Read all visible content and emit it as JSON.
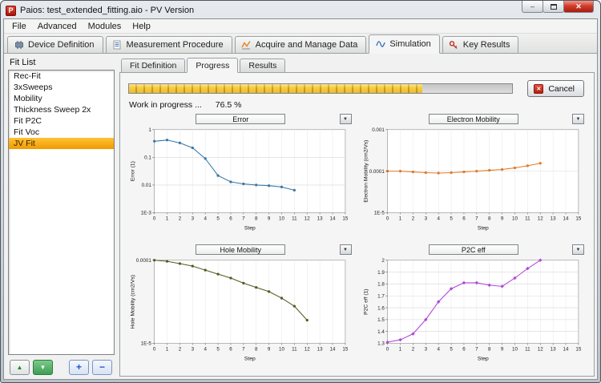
{
  "window": {
    "title": "Paios: test_extended_fitting.aio - PV Version",
    "icon_letter": "P",
    "menu": [
      "File",
      "Advanced",
      "Modules",
      "Help"
    ]
  },
  "glyphs": {
    "minimize": "–",
    "close": "✕",
    "cancel_x": "✕",
    "up_arrow": "▲",
    "down_arrow": "▼",
    "plus": "+",
    "minus": "−",
    "dropdown_arrow": "▼"
  },
  "tabs": {
    "active": "Simulation",
    "items": [
      {
        "label": "Device Definition",
        "icon": "device-icon"
      },
      {
        "label": "Measurement Procedure",
        "icon": "procedure-icon"
      },
      {
        "label": "Acquire and Manage Data",
        "icon": "acquire-data-icon"
      },
      {
        "label": "Simulation",
        "icon": "simulation-icon"
      },
      {
        "label": "Key Results",
        "icon": "key-results-icon"
      }
    ]
  },
  "fit_list": {
    "label": "Fit List",
    "selected": "JV Fit",
    "items": [
      "Rec-Fit",
      "3xSweeps",
      "Mobility",
      "Thickness Sweep 2x",
      "Fit P2C",
      "Fit Voc",
      "JV Fit"
    ]
  },
  "sub_tabs": {
    "active": "Progress",
    "items": [
      "Fit Definition",
      "Progress",
      "Results"
    ]
  },
  "progress": {
    "status_text": "Work in progress ...",
    "percent_text": "76.5 %",
    "percent": 76.5,
    "cancel_label": "Cancel",
    "bar_color": "#f8ca3e"
  },
  "chart_data": [
    {
      "type": "line",
      "title": "Error",
      "xlabel": "Step",
      "ylabel": "Error (1)",
      "yscale": "log",
      "xlim": [
        0,
        15
      ],
      "ylim": [
        0.001,
        1
      ],
      "xticks": [
        0,
        1,
        2,
        3,
        4,
        5,
        6,
        7,
        8,
        9,
        10,
        11,
        12,
        13,
        14,
        15
      ],
      "yticks": [
        {
          "v": 1,
          "label": "1"
        },
        {
          "v": 0.1,
          "label": "0.1"
        },
        {
          "v": 0.01,
          "label": "0.01"
        },
        {
          "v": 0.001,
          "label": "1E-3"
        }
      ],
      "color": "#3878a8",
      "marker": "circle",
      "grid": true,
      "x": [
        0,
        1,
        2,
        3,
        4,
        5,
        6,
        7,
        8,
        9,
        10,
        11
      ],
      "y": [
        0.38,
        0.42,
        0.33,
        0.22,
        0.09,
        0.022,
        0.013,
        0.011,
        0.01,
        0.0095,
        0.0085,
        0.0065
      ]
    },
    {
      "type": "line",
      "title": "Electron Mobility",
      "xlabel": "Step",
      "ylabel": "Electron Mobility (cm2/Vs)",
      "yscale": "log",
      "xlim": [
        0,
        15
      ],
      "ylim": [
        1e-05,
        0.001
      ],
      "xticks": [
        0,
        1,
        2,
        3,
        4,
        5,
        6,
        7,
        8,
        9,
        10,
        11,
        12,
        13,
        14,
        15
      ],
      "yticks": [
        {
          "v": 0.001,
          "label": "0.001"
        },
        {
          "v": 0.0001,
          "label": "0.0001"
        },
        {
          "v": 1e-05,
          "label": "1E-5"
        }
      ],
      "color": "#e07b28",
      "marker": "circle",
      "grid": true,
      "x": [
        0,
        1,
        2,
        3,
        4,
        5,
        6,
        7,
        8,
        9,
        10,
        11,
        12
      ],
      "y": [
        0.0001,
        0.0001,
        9.6e-05,
        9.2e-05,
        9e-05,
        9.2e-05,
        9.6e-05,
        0.0001,
        0.000105,
        0.00011,
        0.00012,
        0.000135,
        0.000155
      ]
    },
    {
      "type": "line",
      "title": "Hole Mobility",
      "xlabel": "Step",
      "ylabel": "Hole Mobility (cm2/Vs)",
      "yscale": "log",
      "xlim": [
        0,
        15
      ],
      "ylim": [
        1e-05,
        0.0001
      ],
      "xticks": [
        0,
        1,
        2,
        3,
        4,
        5,
        6,
        7,
        8,
        9,
        10,
        11,
        12,
        13,
        14,
        15
      ],
      "yticks": [
        {
          "v": 0.0001,
          "label": "0.0001"
        },
        {
          "v": 1e-05,
          "label": "1E-5"
        }
      ],
      "color": "#4e5d20",
      "marker": "circle",
      "grid": true,
      "x": [
        0,
        1,
        2,
        3,
        4,
        5,
        6,
        7,
        8,
        9,
        10,
        11,
        12
      ],
      "y": [
        0.0001,
        9.7e-05,
        9.1e-05,
        8.5e-05,
        7.6e-05,
        6.8e-05,
        6.1e-05,
        5.3e-05,
        4.7e-05,
        4.2e-05,
        3.5e-05,
        2.8e-05,
        1.9e-05
      ]
    },
    {
      "type": "line",
      "title": "P2C eff",
      "xlabel": "Step",
      "ylabel": "P2C eff (1)",
      "yscale": "linear",
      "xlim": [
        0,
        15
      ],
      "ylim": [
        1.3,
        2
      ],
      "xticks": [
        0,
        1,
        2,
        3,
        4,
        5,
        6,
        7,
        8,
        9,
        10,
        11,
        12,
        13,
        14,
        15
      ],
      "yticks": [
        {
          "v": 2,
          "label": "2"
        },
        {
          "v": 1.9,
          "label": "1.9"
        },
        {
          "v": 1.8,
          "label": "1.8"
        },
        {
          "v": 1.7,
          "label": "1.7"
        },
        {
          "v": 1.6,
          "label": "1.6"
        },
        {
          "v": 1.5,
          "label": "1.5"
        },
        {
          "v": 1.4,
          "label": "1.4"
        },
        {
          "v": 1.3,
          "label": "1.3"
        }
      ],
      "color": "#b048d8",
      "marker": "diamond",
      "grid": true,
      "x": [
        0,
        1,
        2,
        3,
        4,
        5,
        6,
        7,
        8,
        9,
        10,
        11,
        12
      ],
      "y": [
        1.31,
        1.33,
        1.38,
        1.5,
        1.65,
        1.76,
        1.81,
        1.81,
        1.79,
        1.78,
        1.85,
        1.93,
        2.0
      ]
    }
  ]
}
